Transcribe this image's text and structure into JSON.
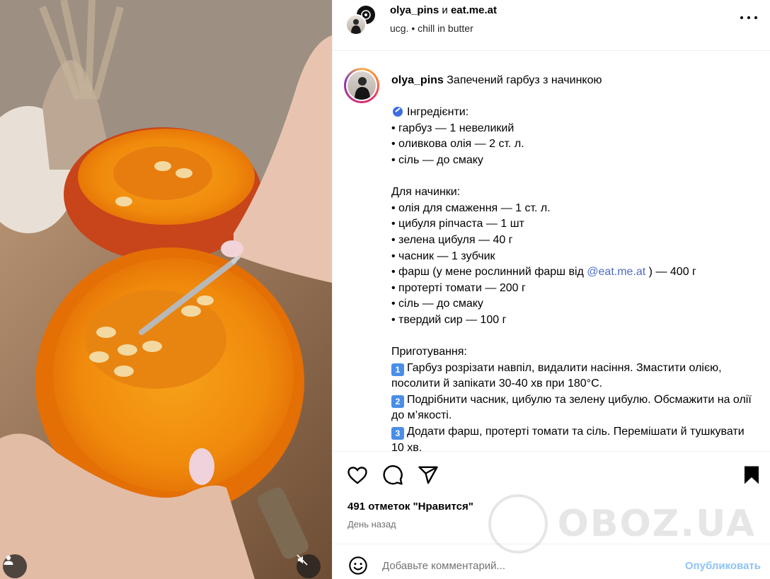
{
  "header": {
    "author": "olya_pins",
    "conjunction": "и",
    "coauthor": "eat.me.at",
    "subtitle": "ucg. • chill in butter"
  },
  "caption": {
    "username": "olya_pins",
    "title": "Запечений гарбуз з начинкою",
    "lines": [
      "",
      "Інгредієнти:",
      "• гарбуз — 1 невеликий",
      "• оливкова олія — 2 ст. л.",
      "• сіль — до смаку",
      "",
      "Для начинки:",
      "• олія для смаження — 1 ст. л.",
      "• цибуля ріпчаста — 1 шт",
      "• зелена цибуля — 40 г",
      "• часник — 1 зубчик"
    ],
    "mince_line_before": "• фарш (у мене рослинний фарш від ",
    "mince_mention": "@eat.me.at",
    "mince_line_after": " ) — 400 г",
    "lines_after": [
      "• протерті томати — 200 г",
      "• сіль — до смаку",
      "• твердий сир — 100 г",
      "",
      "Приготування:"
    ],
    "steps": [
      {
        "num": "1",
        "text": "Гарбуз розрізати навпіл, видалити насіння. Змастити олією, посолити й запікати 30-40 хв при 180°C."
      },
      {
        "num": "2",
        "text": "Подрібнити часник, цибулю та зелену цибулю. Обсмажити на олії до м’якості."
      },
      {
        "num": "3",
        "text": "Додати фарш, протерті томати та сіль. Перемішати й тушкувати 10 хв."
      }
    ]
  },
  "likes": "491 отметок \"Нравится\"",
  "time": "День назад",
  "comment": {
    "placeholder": "Добавьте комментарий...",
    "publish": "Опубликовать"
  },
  "watermark": "OBOZ.UA",
  "icons": {
    "like": "heart-icon",
    "comment": "comment-icon",
    "share": "send-icon",
    "save": "bookmark-icon",
    "emoji": "smiley-icon",
    "more": "more-icon",
    "mute": "muted-speaker-icon",
    "tagged": "user-icon"
  }
}
